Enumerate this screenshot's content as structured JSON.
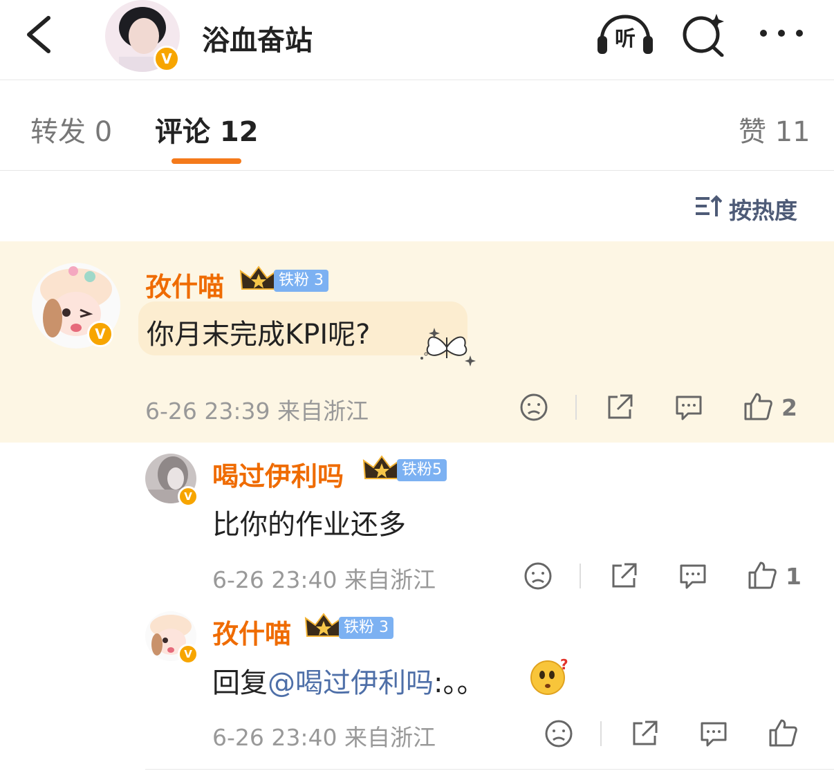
{
  "header": {
    "title": "浴血奋站",
    "listen_label": "听",
    "verified_mark": "V"
  },
  "tabs": {
    "repost": "转发 0",
    "comment": "评论 12",
    "likes": "赞 11"
  },
  "sort": {
    "label": "按热度"
  },
  "comments": [
    {
      "user": "孜什喵",
      "fan_badge": "铁粉 3",
      "text": "你月末完成KPI呢?",
      "time": "6-26 23:39",
      "location": "来自浙江",
      "likes": "2"
    },
    {
      "user": "喝过伊利吗",
      "fan_badge": "铁粉5",
      "text": "比你的作业还多",
      "time": "6-26 23:40",
      "location": "来自浙江",
      "likes": "1"
    },
    {
      "user": "孜什喵",
      "fan_badge": "铁粉 3",
      "text_prefix": "回复",
      "mention": "@喝过伊利吗",
      "text_suffix": ":。。",
      "time": "6-26 23:40",
      "location": "来自浙江",
      "likes": ""
    }
  ],
  "colors": {
    "accent": "#f47a1b",
    "name": "#ef6b00",
    "fan_badge": "#7cb1f2",
    "link": "#4e6fa8",
    "highlight_bg": "#fdf6e4"
  }
}
